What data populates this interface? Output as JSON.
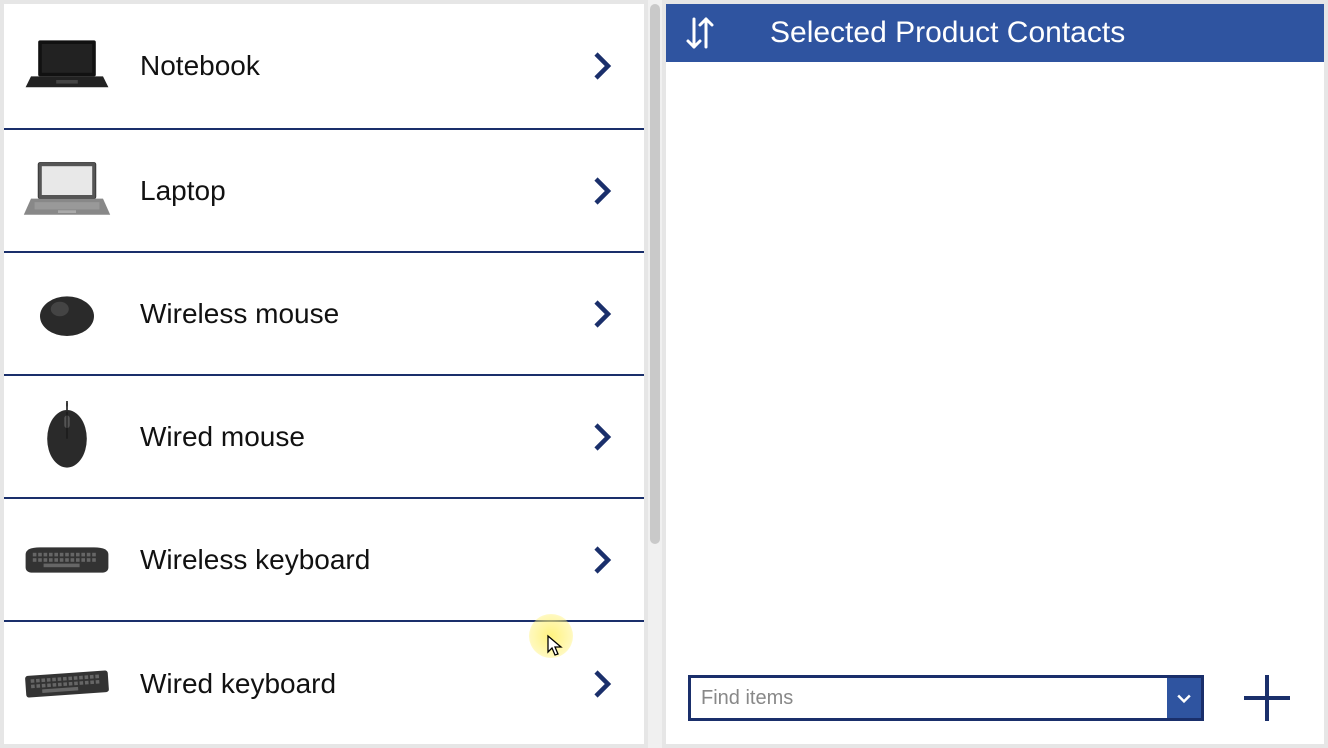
{
  "left": {
    "products": [
      {
        "label": "Notebook",
        "icon": "notebook"
      },
      {
        "label": "Laptop",
        "icon": "laptop"
      },
      {
        "label": "Wireless mouse",
        "icon": "mouse"
      },
      {
        "label": "Wired mouse",
        "icon": "wired-mouse"
      },
      {
        "label": "Wireless keyboard",
        "icon": "keyboard"
      },
      {
        "label": "Wired keyboard",
        "icon": "keyboard"
      }
    ]
  },
  "right": {
    "title": "Selected Product Contacts",
    "find_placeholder": "Find items"
  },
  "colors": {
    "accent": "#2f54a0",
    "accent_dark": "#1a2f6b"
  }
}
